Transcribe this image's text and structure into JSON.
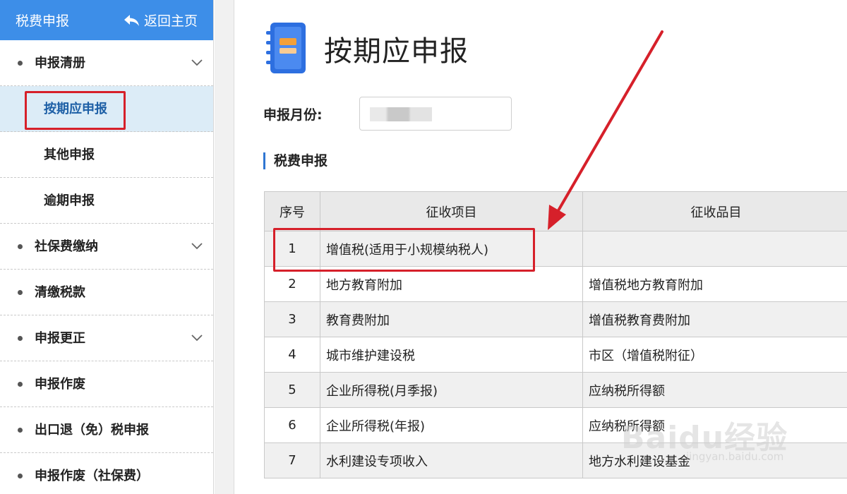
{
  "sidebar": {
    "title": "税费申报",
    "home_label": "返回主页",
    "menu": [
      {
        "label": "申报清册",
        "expandable": true
      },
      {
        "label": "按期应申报",
        "sub": true,
        "active": true
      },
      {
        "label": "其他申报",
        "sub": true
      },
      {
        "label": "逾期申报",
        "sub": true
      },
      {
        "label": "社保费缴纳",
        "expandable": true
      },
      {
        "label": "清缴税款",
        "expandable": false
      },
      {
        "label": "申报更正",
        "expandable": true
      },
      {
        "label": "申报作废",
        "expandable": false
      },
      {
        "label": "出口退（免）税申报",
        "expandable": false
      },
      {
        "label": "申报作废（社保费）",
        "expandable": false
      }
    ]
  },
  "main": {
    "page_title": "按期应申报",
    "month_label": "申报月份:",
    "month_value": "",
    "section_title": "税费申报",
    "table": {
      "headers": [
        "序号",
        "征收项目",
        "征收品目"
      ],
      "rows": [
        {
          "seq": "1",
          "item": "增值税(适用于小规模纳税人)",
          "category": ""
        },
        {
          "seq": "2",
          "item": "地方教育附加",
          "category": "增值税地方教育附加"
        },
        {
          "seq": "3",
          "item": "教育费附加",
          "category": "增值税教育费附加"
        },
        {
          "seq": "4",
          "item": "城市维护建设税",
          "category": "市区（增值税附征）"
        },
        {
          "seq": "5",
          "item": "企业所得税(月季报)",
          "category": "应纳税所得额"
        },
        {
          "seq": "6",
          "item": "企业所得税(年报)",
          "category": "应纳税所得额"
        },
        {
          "seq": "7",
          "item": "水利建设专项收入",
          "category": "地方水利建设基金"
        }
      ]
    }
  },
  "watermark": {
    "brand": "Baidu经验",
    "url": "jingyan.baidu.com"
  },
  "colors": {
    "header_blue": "#3d8ee8",
    "active_bg": "#dcecf7",
    "highlight_red": "#d6202a",
    "arrow_red": "#d6202a"
  }
}
